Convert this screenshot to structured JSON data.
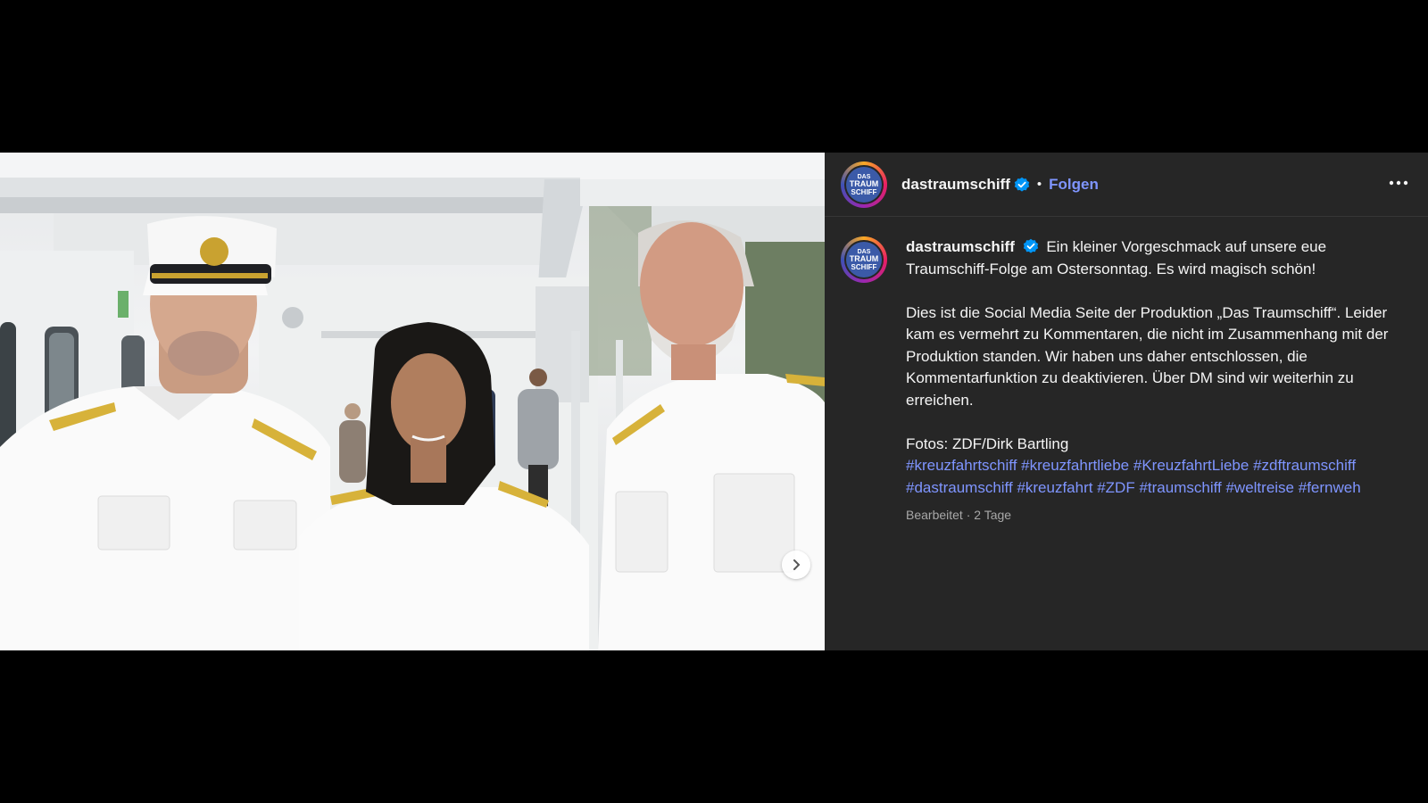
{
  "post": {
    "next_button_icon": "chevron-right-icon",
    "header": {
      "username": "dastraumschiff",
      "verified_icon": "verified-badge-icon",
      "separator": "•",
      "follow_label": "Folgen",
      "more_icon": "more-options-icon"
    },
    "avatar": {
      "logo_line1": "DAS",
      "logo_line2": "TRAUM",
      "logo_line3": "SCHIFF"
    },
    "caption": {
      "username": "dastraumschiff",
      "line1": "Ein kleiner Vorgeschmack auf unsere eue Traumschiff-Folge am Ostersonntag. Es wird magisch schön!",
      "line2": "Dies ist die Social Media Seite der Produktion „Das Traumschiff“. Leider kam es vermehrt zu Kommentaren, die nicht im Zusammenhang mit der Produktion standen. Wir haben uns daher entschlossen, die Kommentarfunktion zu deaktivieren. Über DM sind wir weiterhin zu erreichen.",
      "credits": "Fotos: ZDF/Dirk Bartling",
      "hashtags": [
        "#kreuzfahrtschiff",
        "#kreuzfahrtliebe",
        "#KreuzfahrtLiebe",
        "#zdftraumschiff",
        "#dastraumschiff",
        "#kreuzfahrt",
        "#ZDF",
        "#traumschiff",
        "#weltreise",
        "#fernweh"
      ]
    },
    "meta": {
      "edited": "Bearbeitet",
      "separator": "·",
      "age": "2 Tage"
    }
  },
  "colors": {
    "page_bg": "#000000",
    "sidebar_bg": "#262626",
    "link": "#7f95ff",
    "verified": "#0095f6",
    "secondary_text": "#a8a8a8"
  }
}
